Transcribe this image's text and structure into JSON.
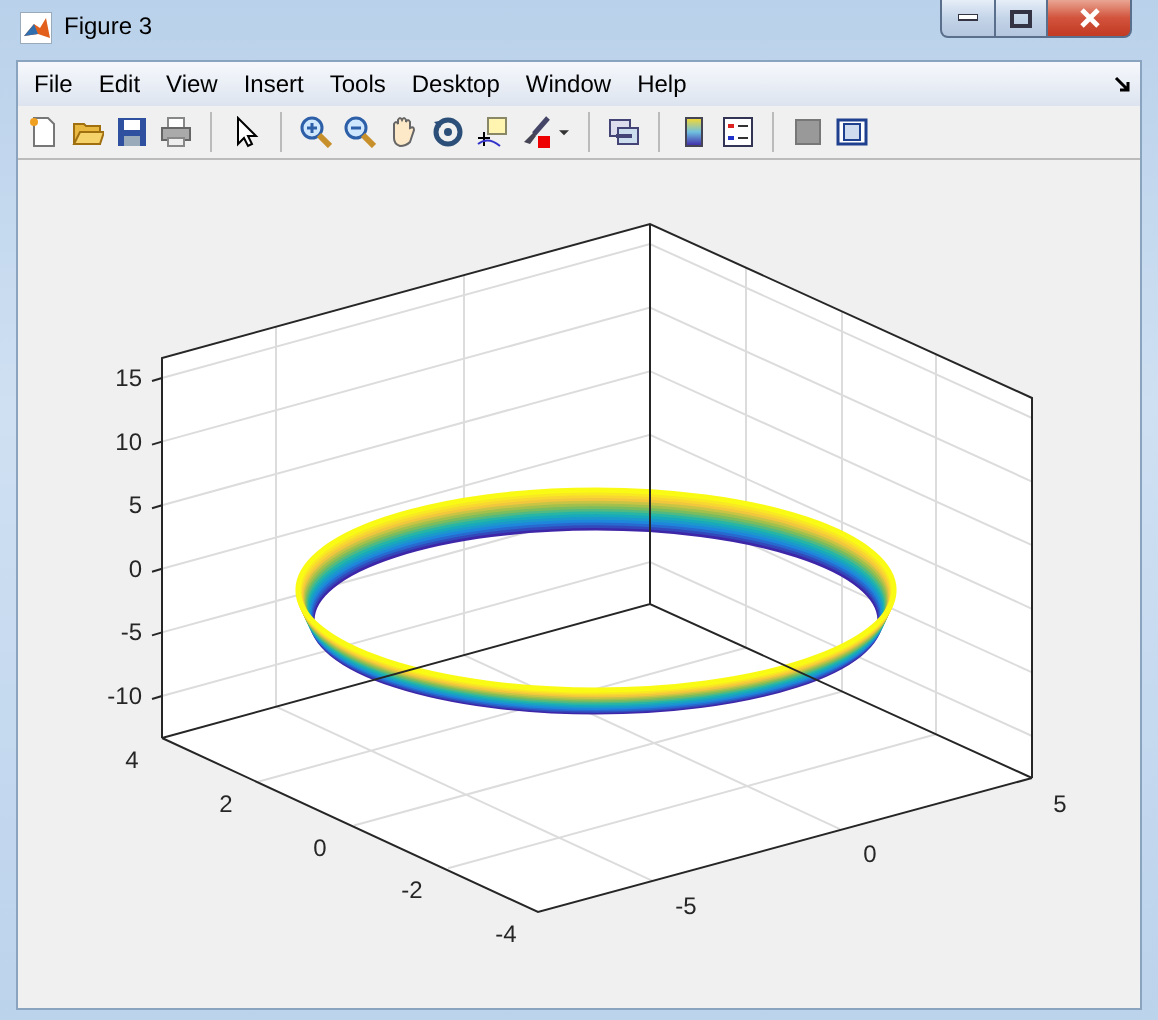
{
  "window": {
    "title": "Figure 3"
  },
  "menu": [
    {
      "label": "File"
    },
    {
      "label": "Edit"
    },
    {
      "label": "View"
    },
    {
      "label": "Insert"
    },
    {
      "label": "Tools"
    },
    {
      "label": "Desktop"
    },
    {
      "label": "Window"
    },
    {
      "label": "Help"
    }
  ],
  "axes": {
    "z_ticks": [
      "15",
      "10",
      "5",
      "0",
      "-5",
      "-10"
    ],
    "y_ticks": [
      "4",
      "2",
      "0",
      "-2",
      "-4"
    ],
    "x_ticks": [
      "-5",
      "0",
      "5"
    ]
  }
}
